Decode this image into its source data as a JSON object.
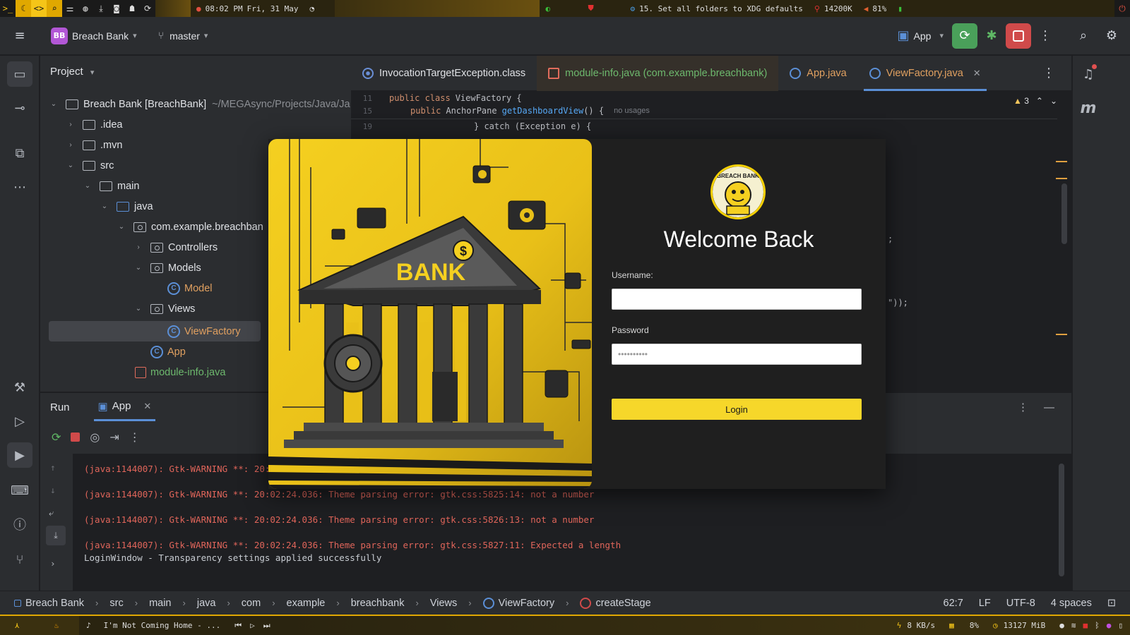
{
  "system_bar": {
    "clock": "08:02 PM",
    "date": "Fri, 31 May",
    "task": "15. Set all folders to XDG defaults",
    "memory": "14200K",
    "volume": "81%"
  },
  "toolbar": {
    "project_badge": "BB",
    "project_name": "Breach Bank",
    "branch": "master",
    "run_config": "App"
  },
  "project_panel": {
    "title": "Project",
    "root": {
      "label": "Breach Bank [BreachBank]",
      "path": "~/MEGAsync/Projects/Java/Ja"
    },
    "items": [
      {
        "label": ".idea"
      },
      {
        "label": ".mvn"
      },
      {
        "label": "src"
      },
      {
        "label": "main"
      },
      {
        "label": "java"
      },
      {
        "label": "com.example.breachban"
      },
      {
        "label": "Controllers"
      },
      {
        "label": "Models"
      },
      {
        "label": "Model"
      },
      {
        "label": "Views"
      },
      {
        "label": "ViewFactory"
      },
      {
        "label": "App"
      },
      {
        "label": "module-info.java"
      }
    ]
  },
  "editor": {
    "tabs": [
      {
        "label": "InvocationTargetException.class"
      },
      {
        "label": "module-info.java (com.example.breachbank)"
      },
      {
        "label": "App.java"
      },
      {
        "label": "ViewFactory.java"
      }
    ],
    "warnings": "3",
    "lines": [
      {
        "num": "11",
        "kw": "public class",
        "text": "ViewFactory {"
      },
      {
        "num": "15",
        "kw": "public",
        "type": "AnchorPane",
        "fn": "getDashboardView",
        "rest": "() {",
        "hint": "no usages"
      },
      {
        "num": "19",
        "text": "} catch (Exception e) {"
      }
    ],
    "fragment_a": ";",
    "fragment_b": "\"));"
  },
  "run_panel": {
    "title": "Run",
    "tab": "App",
    "console": [
      {
        "text": "(java:1144007): Gtk-WARNING **: 20:"
      },
      {
        "text": "(java:1144007): Gtk-WARNING **: 20:02:24.036: Theme parsing error: gtk.css:5825:14: not a number"
      },
      {
        "text": "(java:1144007): Gtk-WARNING **: 20:02:24.036: Theme parsing error: gtk.css:5826:13: not a number"
      },
      {
        "text": "(java:1144007): Gtk-WARNING **: 20:02:24.036: Theme parsing error: gtk.css:5827:11: Expected a length"
      },
      {
        "text": "LoginWindow - Transparency settings applied successfully"
      }
    ]
  },
  "status_bar": {
    "breadcrumbs": [
      "Breach Bank",
      "src",
      "main",
      "java",
      "com",
      "example",
      "breachbank",
      "Views",
      "ViewFactory",
      "createStage"
    ],
    "position": "62:7",
    "line_ending": "LF",
    "encoding": "UTF-8",
    "indent": "4 spaces"
  },
  "taskbar": {
    "media": "I'm Not Coming Home - ...",
    "net": "8 KB/s",
    "cpu": "8%",
    "ram": "13127 MiB"
  },
  "login": {
    "logo_text": "BREACH BANK",
    "art_text": "BANK",
    "title": "Welcome Back",
    "username_label": "Username:",
    "username_value": "",
    "password_label": "Password",
    "password_value": "••••••••••",
    "button": "Login"
  },
  "colors": {
    "accent": "#5b8fd6",
    "login_button": "#f6d72a",
    "error_text": "#e0655a",
    "run_green": "#4aa05a",
    "stop_red": "#d04a4a"
  }
}
